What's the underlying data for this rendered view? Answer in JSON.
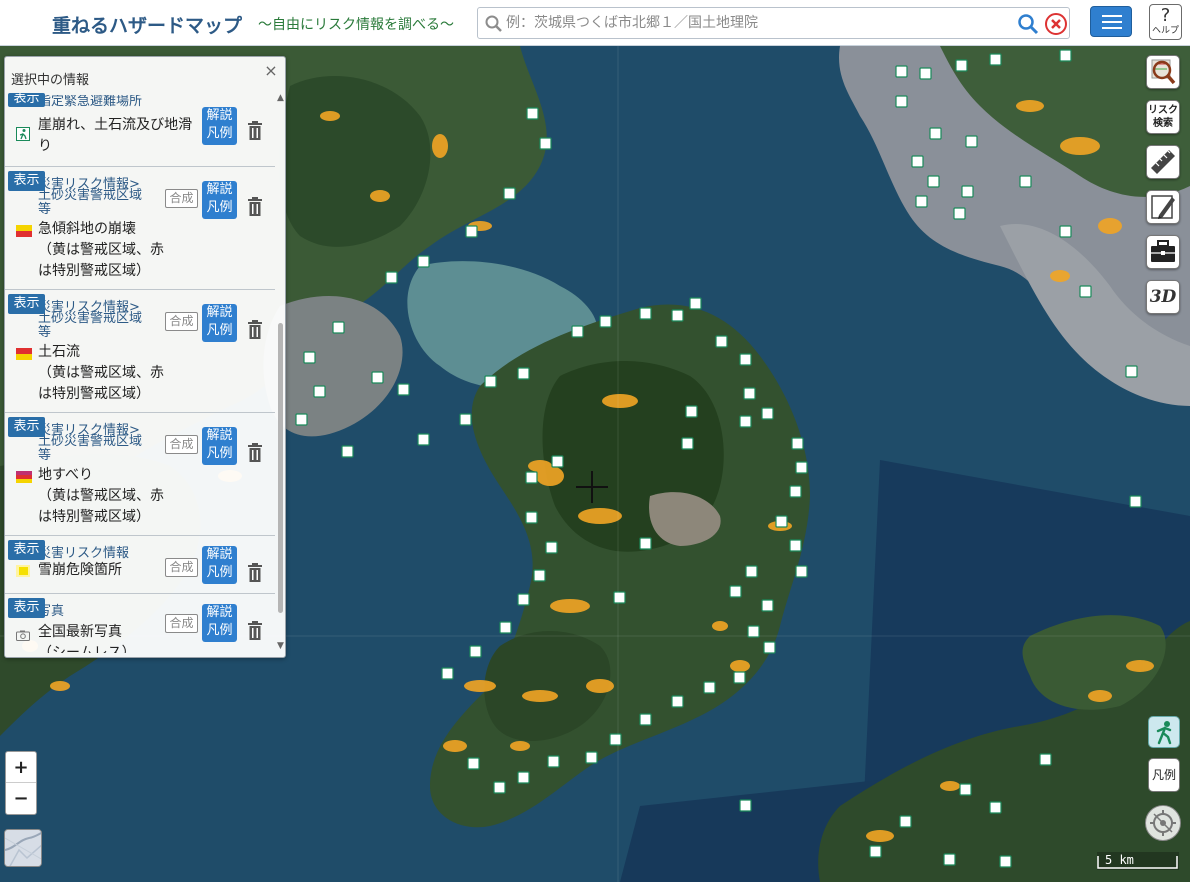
{
  "header": {
    "title": "重ねるハザードマップ",
    "subtitle": "～自由にリスク情報を調べる～",
    "search_placeholder": "例：茨城県つくば市北郷１／国土地理院",
    "help_label": "ヘルプ",
    "help_symbol": "?"
  },
  "panel": {
    "title": "選択中の情報",
    "close_symbol": "×",
    "layers": [
      {
        "show": "表示",
        "category": "指定緊急避難場所",
        "name": "崖崩れ、土石流及び地滑り",
        "kaisetsu": "解説",
        "hanrei": "凡例",
        "icon": "evacuation-site-icon"
      },
      {
        "show": "表示",
        "category": "災害リスク情報>",
        "subcategory": "土砂災害警戒区域等",
        "name": "急傾斜地の崩壊",
        "note": "（黄は警戒区域、赤は特別警戒区域）",
        "gosei": "合成",
        "kaisetsu": "解説",
        "hanrei": "凡例",
        "icon": "yellow-red-swatch-icon"
      },
      {
        "show": "表示",
        "category": "災害リスク情報>",
        "subcategory": "土砂災害警戒区域等",
        "name": "土石流",
        "note": "（黄は警戒区域、赤は特別警戒区域）",
        "gosei": "合成",
        "kaisetsu": "解説",
        "hanrei": "凡例",
        "icon": "yellow-red-swatch-icon"
      },
      {
        "show": "表示",
        "category": "災害リスク情報>",
        "subcategory": "土砂災害警戒区域等",
        "name": "地すべり",
        "note": "（黄は警戒区域、赤は特別警戒区域）",
        "gosei": "合成",
        "kaisetsu": "解説",
        "hanrei": "凡例",
        "icon": "yellow-red-swatch-icon"
      },
      {
        "show": "表示",
        "category": "災害リスク情報",
        "name": "雪崩危険箇所",
        "gosei": "合成",
        "kaisetsu": "解説",
        "hanrei": "凡例",
        "icon": "yellow-swatch-icon"
      },
      {
        "show": "表示",
        "category": "写真",
        "name": "全国最新写真",
        "note": "（シームレス）",
        "gosei": "合成",
        "kaisetsu": "解説",
        "hanrei": "凡例",
        "icon": "camera-icon"
      }
    ]
  },
  "toolbar": {
    "risk_search_line1": "リスク",
    "risk_search_line2": "検索",
    "three_d": "3D",
    "legend": "凡例"
  },
  "zoom": {
    "in": "+",
    "out": "−"
  },
  "scale": {
    "label": "5 km"
  },
  "colors": {
    "accent": "#2f7fcf",
    "show_button": "#2a6ea8",
    "hazard_yellow": "#f2a524",
    "sea": "#1d4966",
    "evac_icon": "#1a8a5a"
  }
}
